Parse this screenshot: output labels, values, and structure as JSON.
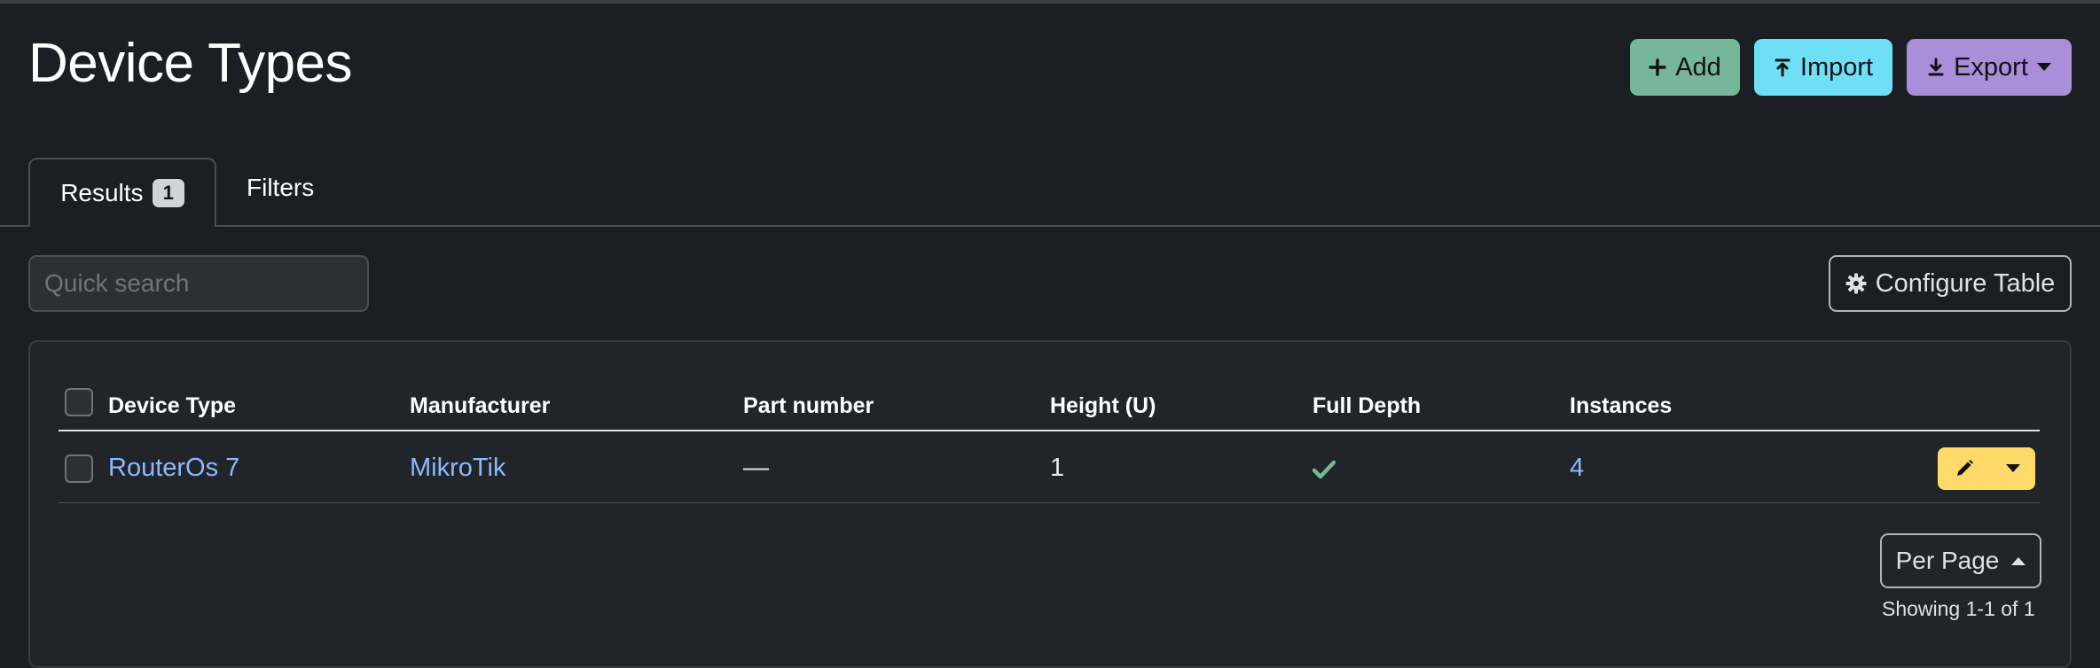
{
  "page": {
    "title": "Device Types"
  },
  "header_buttons": {
    "add_label": "Add",
    "import_label": "Import",
    "export_label": "Export"
  },
  "tabs": {
    "results_label": "Results",
    "results_count": "1",
    "filters_label": "Filters"
  },
  "search": {
    "placeholder": "Quick search"
  },
  "configure": {
    "label": "Configure Table"
  },
  "table": {
    "columns": [
      "Device Type",
      "Manufacturer",
      "Part number",
      "Height (U)",
      "Full Depth",
      "Instances"
    ],
    "rows": [
      {
        "device_type": "RouterOs 7",
        "manufacturer": "MikroTik",
        "part_number": "—",
        "height": "1",
        "full_depth": "check-icon",
        "instances": "4"
      }
    ]
  },
  "pagination": {
    "per_page_label": "Per Page",
    "showing": "Showing 1-1 of 1"
  },
  "colors": {
    "add": "#75b798",
    "import": "#6edff6",
    "export": "#a98eda",
    "edit": "#ffda6a",
    "link": "#8bb9fe",
    "check": "#75b798"
  }
}
